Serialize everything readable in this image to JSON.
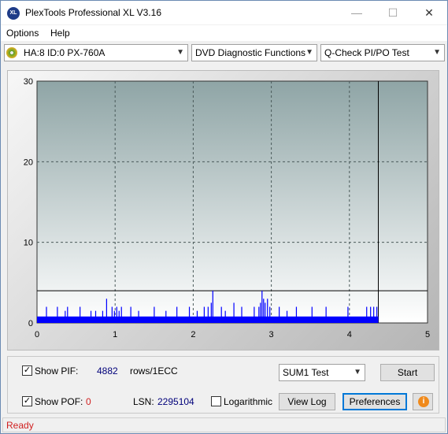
{
  "window": {
    "title": "PlexTools Professional XL V3.16",
    "app_icon_text": "XL",
    "controls": {
      "minimize": "—",
      "maximize": "☐",
      "close": "✕"
    }
  },
  "menu": {
    "options": "Options",
    "help": "Help"
  },
  "toolbar": {
    "drive": "HA:8 ID:0  PX-760A",
    "function": "DVD Diagnostic Functions",
    "test": "Q-Check PI/PO Test"
  },
  "chart_data": {
    "type": "bar",
    "xlim": [
      0,
      5
    ],
    "ylim": [
      0,
      30
    ],
    "x_ticks": [
      "0",
      "1",
      "2",
      "3",
      "4",
      "5"
    ],
    "y_ticks": [
      "0",
      "10",
      "20",
      "30"
    ],
    "grid": true,
    "threshold_line": 4,
    "end_marker_x": 4.37,
    "series": [
      {
        "baseline": 0.8,
        "baseline_end": 4.37,
        "spikes": [
          [
            0.12,
            2
          ],
          [
            0.26,
            2
          ],
          [
            0.36,
            1.5
          ],
          [
            0.39,
            2
          ],
          [
            0.55,
            2
          ],
          [
            0.69,
            1.5
          ],
          [
            0.75,
            1.5
          ],
          [
            0.84,
            1.5
          ],
          [
            0.89,
            3
          ],
          [
            0.96,
            2
          ],
          [
            0.99,
            1.5
          ],
          [
            1.02,
            2
          ],
          [
            1.05,
            1.5
          ],
          [
            1.08,
            2
          ],
          [
            1.2,
            2
          ],
          [
            1.3,
            1.5
          ],
          [
            1.5,
            2
          ],
          [
            1.65,
            1.5
          ],
          [
            1.79,
            2
          ],
          [
            1.95,
            2
          ],
          [
            2.05,
            1.5
          ],
          [
            2.14,
            2
          ],
          [
            2.19,
            2
          ],
          [
            2.23,
            2.5
          ],
          [
            2.25,
            4
          ],
          [
            2.36,
            2
          ],
          [
            2.41,
            1.5
          ],
          [
            2.52,
            2.5
          ],
          [
            2.62,
            2
          ],
          [
            2.78,
            2
          ],
          [
            2.84,
            2
          ],
          [
            2.86,
            2.5
          ],
          [
            2.88,
            4
          ],
          [
            2.9,
            3
          ],
          [
            2.92,
            2.5
          ],
          [
            2.95,
            3
          ],
          [
            2.98,
            2
          ],
          [
            3.1,
            2
          ],
          [
            3.2,
            1.5
          ],
          [
            3.32,
            2
          ],
          [
            3.52,
            2
          ],
          [
            3.7,
            2
          ],
          [
            3.98,
            2
          ],
          [
            4.22,
            2
          ],
          [
            4.27,
            2
          ],
          [
            4.31,
            2
          ],
          [
            4.35,
            2
          ]
        ]
      }
    ],
    "colors": {
      "plot_top": "#8fa5a6",
      "plot_bottom": "#ffffff",
      "bars": "#0000ff",
      "grid": "#4a5a5a"
    }
  },
  "controls": {
    "show_pif_label": "Show PIF:",
    "pif_value": "4882",
    "rows_label": "rows/1ECC",
    "show_pof_label": "Show POF:",
    "pof_value": "0",
    "lsn_label": "LSN:",
    "lsn_value": "2295104",
    "logarithmic_label": "Logarithmic",
    "test_select": "SUM1 Test",
    "start_button": "Start",
    "view_log_button": "View Log",
    "preferences_button": "Preferences",
    "info_icon": "i",
    "checkbox_mark": "✓",
    "show_pif_checked": true,
    "show_pof_checked": true,
    "logarithmic_checked": false
  },
  "status": {
    "text": "Ready"
  }
}
